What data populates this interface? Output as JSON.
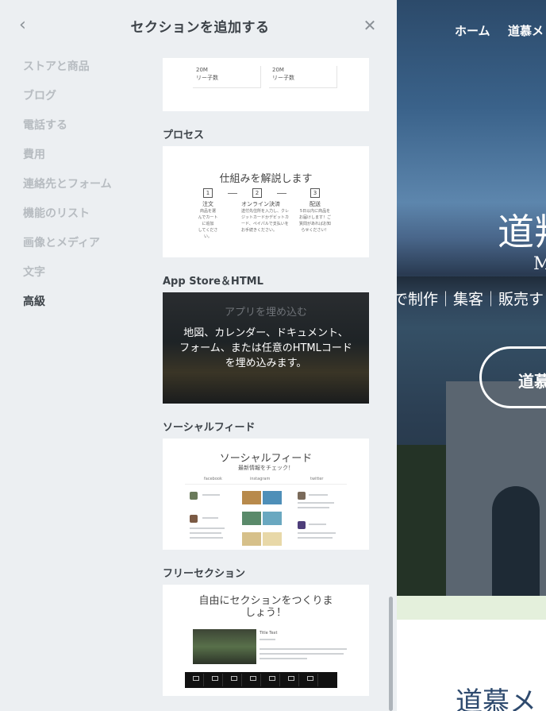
{
  "panel": {
    "back_icon": "chevron-left-icon",
    "title": "セクションを追加する",
    "close_icon": "close-icon",
    "categories": [
      {
        "label": "ストアと商品",
        "active": false
      },
      {
        "label": "ブログ",
        "active": false
      },
      {
        "label": "電話する",
        "active": false
      },
      {
        "label": "費用",
        "active": false
      },
      {
        "label": "連絡先とフォーム",
        "active": false
      },
      {
        "label": "機能のリスト",
        "active": false
      },
      {
        "label": "画像とメディア",
        "active": false
      },
      {
        "label": "文字",
        "active": false
      },
      {
        "label": "高級",
        "active": true
      }
    ]
  },
  "sections": {
    "partial": {
      "stats": [
        {
          "value": "20M",
          "label": "リー子数"
        },
        {
          "value": "20M",
          "label": "リー子数"
        }
      ]
    },
    "process": {
      "title": "プロセス",
      "preview_heading": "仕組みを解説します",
      "steps": [
        {
          "num": "1",
          "title": "注文",
          "desc": [
            "商品を選",
            "んでカート",
            "に追加",
            "してくださ",
            "い。"
          ]
        },
        {
          "num": "2",
          "title": "オンライン決済",
          "desc": [
            "送付先住所を入力し、クレ",
            "ジットカードかデビットカ",
            "ード、ペイパルで支払いを",
            "お手続きください。"
          ]
        },
        {
          "num": "3",
          "title": "配送",
          "desc": [
            "5日以内に商品を",
            "お届けします！ご",
            "質問があればお知",
            "らせください！"
          ]
        }
      ]
    },
    "appstore": {
      "title": "App Store＆HTML",
      "preview_heading": "アプリを埋め込む",
      "description": "地図、カレンダー、ドキュメント、フォーム、または任意のHTMLコードを埋め込みます。"
    },
    "social": {
      "title": "ソーシャルフィード",
      "preview_heading": "ソーシャルフィード",
      "preview_sub": "最新情報をチェック！",
      "networks": [
        "facebook",
        "instagram",
        "twitter"
      ]
    },
    "free": {
      "title": "フリーセクション",
      "preview_heading": "自由にセクションをつくりましょう！",
      "preview_item_title": "Title Text"
    }
  },
  "preview": {
    "nav": [
      "ホーム",
      "道慕メ"
    ],
    "hero_title": "道叛",
    "hero_sub": "M",
    "hero_tagline": "で制作｜集客｜販売す",
    "cta_label": "道慕",
    "bottom_title": "道慕メ"
  },
  "colors": {
    "panel_bg": "#eceff2",
    "category_inactive": "#b7bcc1",
    "category_active": "#3c4248",
    "accent_green": "#e4f0dc"
  }
}
